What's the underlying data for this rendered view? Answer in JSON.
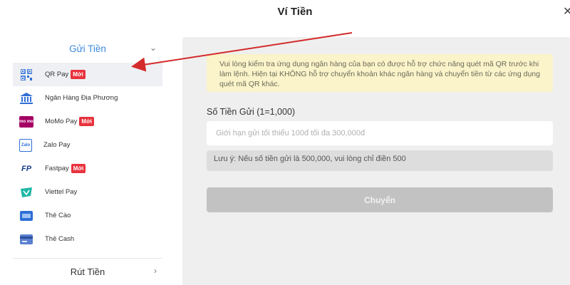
{
  "header": {
    "title": "Ví Tiền",
    "close_glyph": "✕"
  },
  "sidebar": {
    "deposit_label": "Gửi Tiền",
    "withdraw_label": "Rút Tiền",
    "expand_icon": "chevron-down-icon",
    "collapse_icon": "chevron-right-icon",
    "items": [
      {
        "label": "QR Pay",
        "badge": "Mới",
        "icon": "qr-code-icon",
        "active": true
      },
      {
        "label": "Ngân Hàng Địa Phương",
        "badge": "",
        "icon": "bank-icon"
      },
      {
        "label": "MoMo Pay",
        "badge": "Mới",
        "icon": "momo-logo-icon",
        "icon_text": "mo mo"
      },
      {
        "label": "Zalo Pay",
        "badge": "",
        "icon": "zalopay-logo-icon",
        "icon_text": "Zalo"
      },
      {
        "label": "Fastpay",
        "badge": "Mới",
        "icon": "fastpay-logo-icon",
        "icon_text": "FP"
      },
      {
        "label": "Viettel Pay",
        "badge": "",
        "icon": "viettelpay-logo-icon"
      },
      {
        "label": "Thẻ Cào",
        "badge": "",
        "icon": "scratch-card-icon"
      },
      {
        "label": "Thẻ Cash",
        "badge": "",
        "icon": "cash-card-icon"
      }
    ]
  },
  "main": {
    "notice": "Vui lòng kiểm tra ứng dụng ngân hàng của bạn có được hỗ trợ chức năng quét mã QR trước khi làm lệnh. Hiện tại KHÔNG hỗ trợ chuyển khoản khác ngân hàng và chuyển tiền từ các ứng dụng quét mã QR khác.",
    "amount_label": "Số Tiền Gửi (1=1,000)",
    "amount_value": "",
    "amount_placeholder": "Giới hạn gửi tối thiểu 100đ tối đa 300,000đ",
    "note": "Lưu ý: Nếu số tiền gửi là 500,000, vui lòng chỉ điền 500",
    "submit_label": "Chuyển"
  },
  "colors": {
    "accent": "#3d8be0",
    "badge": "#e8323c",
    "notice_bg": "#fbf3c9",
    "arrow": "#d42a2a",
    "panel_bg": "#efefef"
  }
}
